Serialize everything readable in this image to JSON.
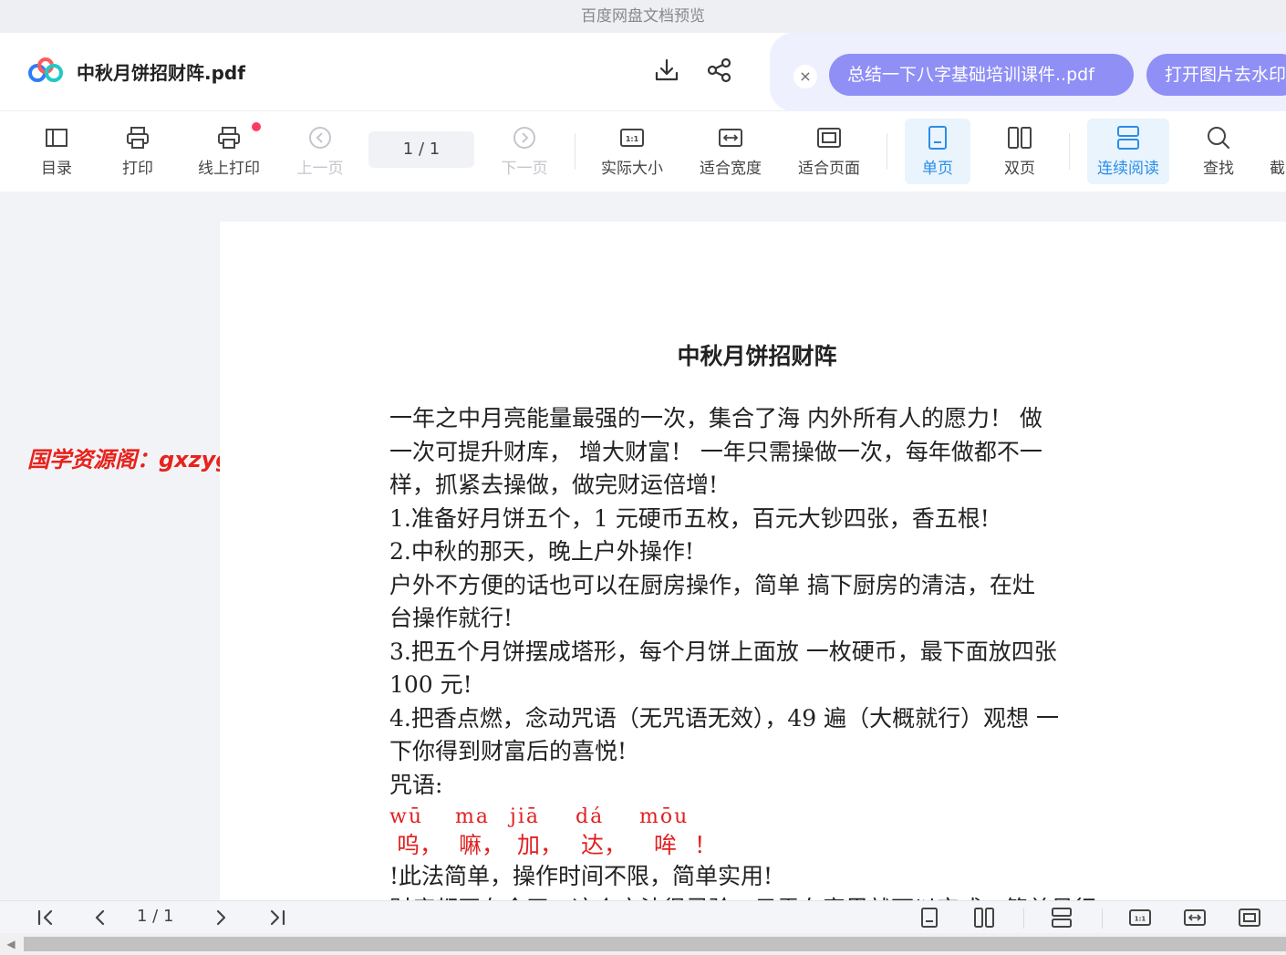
{
  "window": {
    "title": "百度网盘文档预览"
  },
  "header": {
    "filename": "中秋月饼招财阵.pdf",
    "tabs": [
      {
        "label": "总结一下八字基础培训课件..pdf"
      },
      {
        "label": "打开图片去水印"
      }
    ],
    "close_label": "×"
  },
  "toolbar": {
    "toc_label": "目录",
    "print_label": "打印",
    "online_print_label": "线上打印",
    "prev_label": "上一页",
    "page_indicator": "1  / 1",
    "next_label": "下一页",
    "actual_size_label": "实际大小",
    "fit_width_label": "适合宽度",
    "fit_page_label": "适合页面",
    "single_label": "单页",
    "double_label": "双页",
    "continuous_label": "连续阅读",
    "search_label": "查找",
    "more_label": "截"
  },
  "document": {
    "title": "中秋月饼招财阵",
    "lines": [
      "一年之中月亮能量最强的一次，集合了海 内外所有人的愿力！ 做",
      "一次可提升财库，  增大财富！  一年只需操做一次，每年做都不一",
      "样，抓紧去操做，做完财运倍增!",
      "1.准备好月饼五个，1  元硬币五枚，百元大钞四张，香五根!",
      "2.中秋的那天，晚上户外操作!",
      "户外不方便的话也可以在厨房操作，简单 搞下厨房的清洁，在灶",
      "台操作就行!",
      "3.把五个月饼摆成塔形，每个月饼上面放 一枚硬币，最下面放四张",
      "100  元!",
      "4.把香点燃，念动咒语（无咒语无效），49  遍（大概就行）观想 一",
      "下你得到财富后的喜悦!",
      "咒语:"
    ],
    "mantra_pinyin": [
      "wū",
      "ma",
      "jiā",
      "dá",
      "mōu"
    ],
    "mantra_chars": [
      "呜，",
      "嘛，",
      "加，",
      "达，",
      "哞",
      "！"
    ],
    "after": "!此法简单，操作时间不限，简单实用!",
    "cut_line": "财库都开在今天，这个方法很灵验，只需在家里就可以完成，简单易行，每年一次"
  },
  "watermark": {
    "text": "国学资源阁：gxzyg.cn"
  },
  "bottombar": {
    "page_indicator": "1  / 1"
  },
  "colors": {
    "accent": "#2b8de8",
    "tab_pill": "#8f8ff6",
    "watermark": "#e8221c",
    "mantra": "#e02020"
  }
}
